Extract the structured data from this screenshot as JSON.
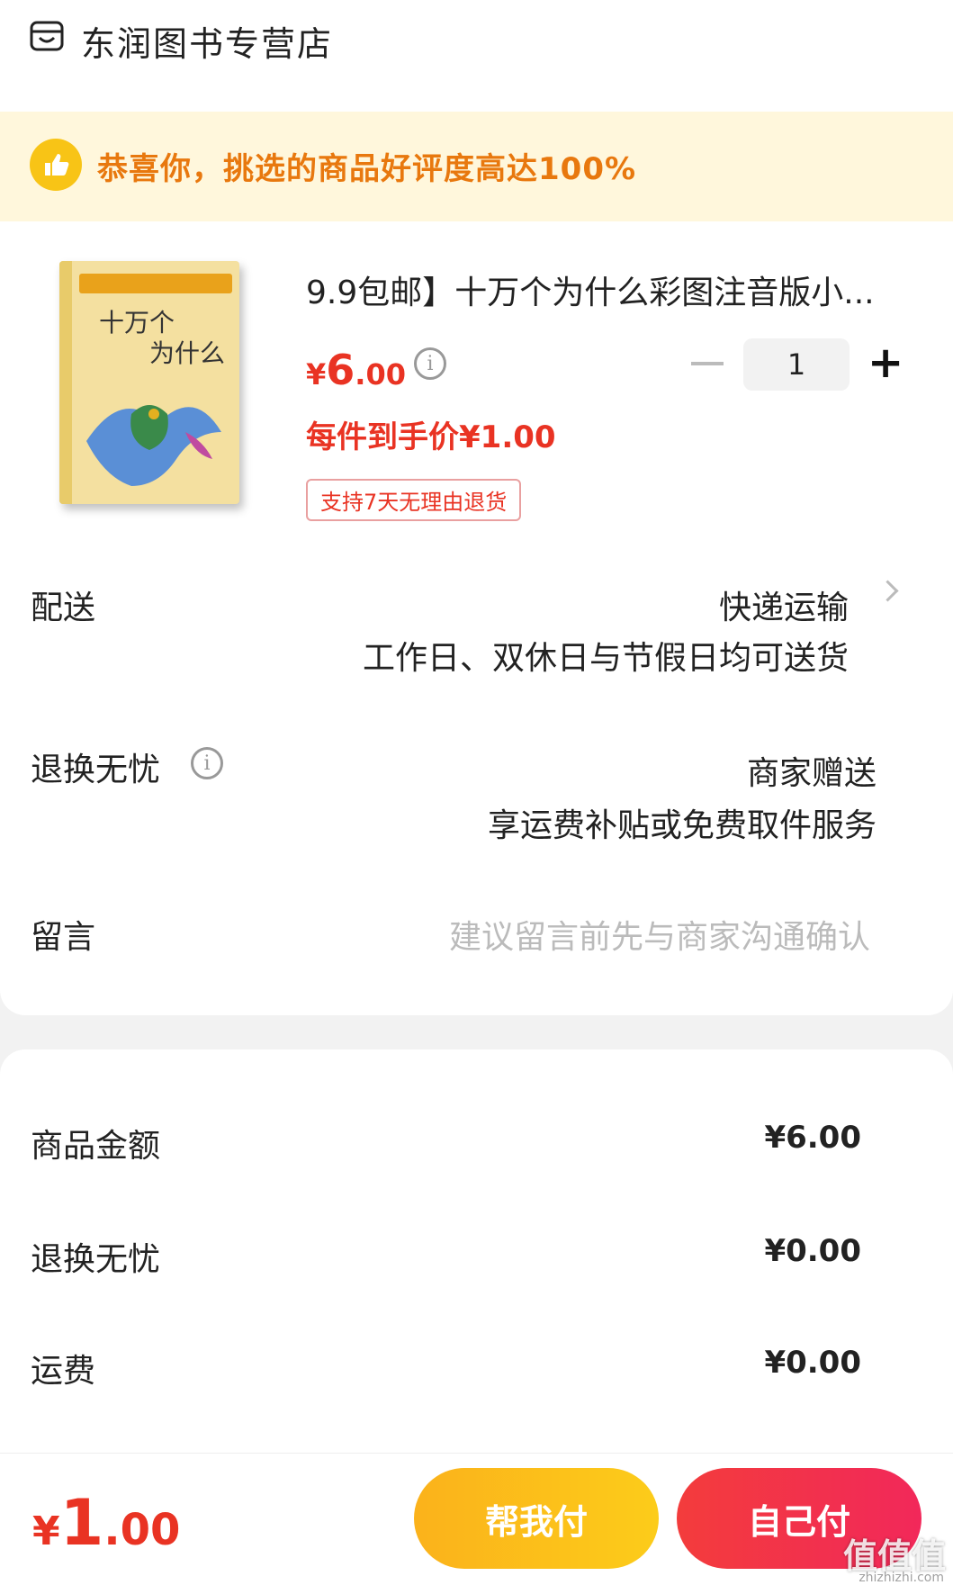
{
  "shop": {
    "name": "东润图书专营店",
    "icon": "shop-icon"
  },
  "banner": {
    "text": "恭喜你，挑选的商品好评度高达100%",
    "icon": "thumbs-up-icon"
  },
  "product": {
    "title": "9.9包邮】十万个为什么彩图注音版小...",
    "cover_title_line1": "十万个",
    "cover_title_line2": "为什么",
    "price_symbol": "¥",
    "price_int": "6",
    "price_dec": ".00",
    "quantity": "1",
    "unit_price": "每件到手价¥1.00",
    "return_badge": "支持7天无理由退货"
  },
  "delivery": {
    "label": "配送",
    "method": "快递运输",
    "note": "工作日、双休日与节假日均可送货"
  },
  "return_service": {
    "label": "退换无忧",
    "value": "商家赠送",
    "note": "享运费补贴或免费取件服务"
  },
  "remark": {
    "label": "留言",
    "placeholder": "建议留言前先与商家沟通确认"
  },
  "summary": {
    "items": [
      {
        "label": "商品金额",
        "value": "¥6.00"
      },
      {
        "label": "退换无忧",
        "value": "¥0.00"
      },
      {
        "label": "运费",
        "value": "¥0.00"
      }
    ]
  },
  "footer": {
    "total_symbol": "¥",
    "total_int": "1",
    "total_dec": ".00",
    "help_pay_label": "帮我付",
    "self_pay_label": "自己付",
    "watermark": "值值值",
    "watermark_url": "zhizhizhi.com"
  },
  "colors": {
    "accent": "#e93323",
    "banner_text": "#e8780e",
    "help_button": "#fbb21b"
  }
}
